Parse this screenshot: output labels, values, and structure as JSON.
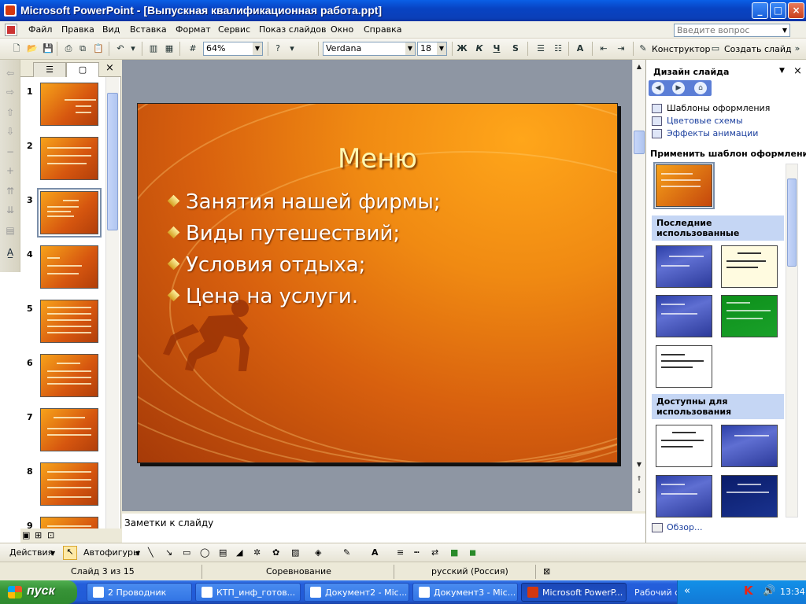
{
  "window": {
    "title": "Microsoft PowerPoint - [Выпускная квалификационная работа.ppt]",
    "min": "_",
    "max": "□",
    "close": "×"
  },
  "menu": {
    "items": [
      "Файл",
      "Правка",
      "Вид",
      "Вставка",
      "Формат",
      "Сервис",
      "Показ слайдов",
      "Окно",
      "Справка"
    ],
    "ask_placeholder": "Введите вопрос"
  },
  "toolbar": {
    "zoom": "64%",
    "font": "Verdana",
    "font_size": "18",
    "bold": "Ж",
    "italic": "К",
    "underline": "Ч",
    "shadow": "S",
    "constructor": "Конструктор",
    "new_slide": "Создать слайд"
  },
  "left_panel": {
    "slide_numbers": [
      "1",
      "2",
      "3",
      "4",
      "5",
      "6",
      "7",
      "8",
      "9"
    ],
    "selected_slide": 3
  },
  "slide": {
    "title": "Меню",
    "bullets": [
      "Занятия нашей фирмы;",
      "Виды путешествий;",
      "Условия отдыха;",
      "Цена на услуги."
    ]
  },
  "notes": {
    "placeholder": "Заметки к слайду"
  },
  "task_pane": {
    "title": "Дизайн слайда",
    "links": [
      "Шаблоны оформления",
      "Цветовые схемы",
      "Эффекты анимации"
    ],
    "apply_label": "Применить шаблон оформления:",
    "recent_header": "Последние использованные",
    "available_header": "Доступны для использования",
    "browse": "Обзор..."
  },
  "drawing": {
    "actions": "Действия",
    "autoshapes": "Автофигуры"
  },
  "status": {
    "slide": "Слайд 3 из 15",
    "design": "Соревнование",
    "language": "русский (Россия)"
  },
  "taskbar": {
    "start": "пуск",
    "tasks": [
      "2 Проводник",
      "КТП_инф_готов...",
      "Документ2 - Mic...",
      "Документ3 - Mic...",
      "Microsoft PowerP..."
    ],
    "desktop": "Рабочий стол",
    "clock": "13:34"
  }
}
